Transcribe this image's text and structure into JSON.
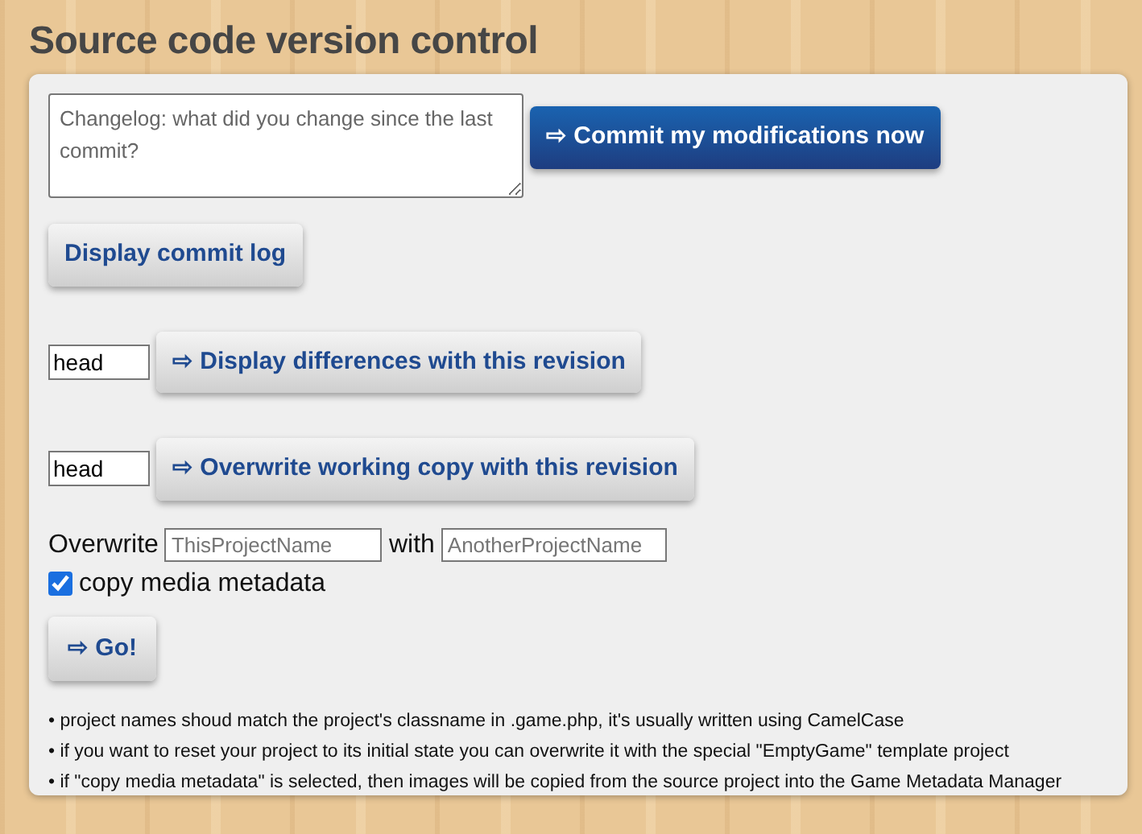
{
  "heading": "Source code version control",
  "commit": {
    "placeholder": "Changelog: what did you change since the last commit?",
    "button": "⇨ Commit my modifications now"
  },
  "log_button": "Display commit log",
  "revisions": [
    {
      "value": "head",
      "button": "⇨ Display differences with this revision"
    },
    {
      "value": "head",
      "button": "⇨ Overwrite working copy with this revision"
    }
  ],
  "overwrite": {
    "label": "Overwrite",
    "source_placeholder": "ThisProjectName",
    "with_label": "with",
    "target_placeholder": "AnotherProjectName",
    "checkbox": {
      "label": "copy media metadata",
      "checked": true
    },
    "button": "⇨ Go!"
  },
  "notes": [
    "• project names shoud match the project's classname in .game.php, it's usually written using CamelCase",
    "• if you want to reset your project to its initial state you can overwrite it with the special \"EmptyGame\" template project",
    "• if \"copy media metadata\" is selected, then images will be copied from the source project into the Game Metadata Manager"
  ]
}
